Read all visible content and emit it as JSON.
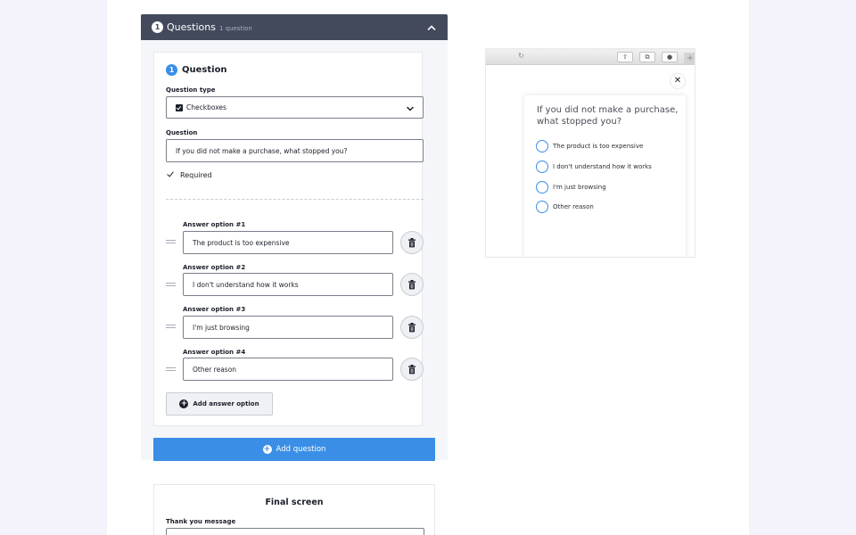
{
  "questions_section": {
    "number": "1",
    "title": "Questions",
    "count": "1 question"
  },
  "question": {
    "number": "1",
    "heading": "Question",
    "type_label": "Question type",
    "type_value": "Checkboxes",
    "question_label": "Question",
    "question_value": "If you did not make a purchase, what stopped you?",
    "required_label": "Required",
    "answer_options": [
      {
        "label": "Answer option #1",
        "value": "The product is too expensive"
      },
      {
        "label": "Answer option #2",
        "value": "I don't understand how it works"
      },
      {
        "label": "Answer option #3",
        "value": "I'm just browsing"
      },
      {
        "label": "Answer option #4",
        "value": "Other reason"
      }
    ],
    "add_option_label": "Add answer option"
  },
  "add_question_label": "Add question",
  "final_screen": {
    "title": "Final screen",
    "thank_you_label": "Thank you message"
  },
  "preview": {
    "question": "If you did not make a purchase, what stopped you?",
    "options": [
      "The product is too expensive",
      "I don't understand how it works",
      "I'm just browsing",
      "Other reason"
    ]
  },
  "colors": {
    "accent": "#3a8ee6",
    "header_bar": "#434a5c",
    "background": "#f4f3fb"
  }
}
